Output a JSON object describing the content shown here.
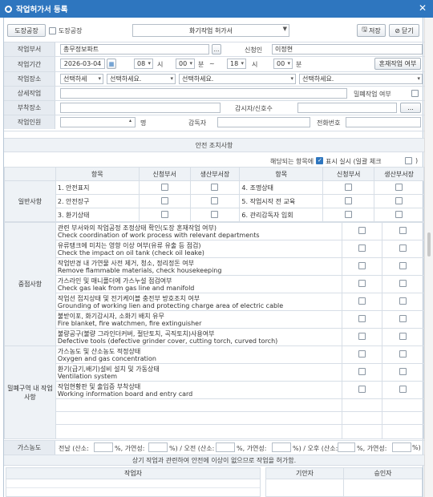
{
  "window": {
    "title": "작업허가서 등록",
    "close": "✕"
  },
  "toolbar": {
    "org_button": "도장공장",
    "org_check_label": "도장공장",
    "form_type": "화기작업 허가서",
    "save_label": "저장",
    "close_label": "닫기"
  },
  "form": {
    "dept_label": "작업부서",
    "dept_value": "총무정보파트",
    "applicant_label": "신청인",
    "applicant_value": "이정현",
    "period_label": "작업기간",
    "date_value": "2026-03-04",
    "start_hour": "08",
    "hour_unit": "시",
    "start_min": "00",
    "min_unit": "분",
    "tilde": "~",
    "end_hour": "18",
    "end_min": "00",
    "mixed_work_button": "혼재작업 여부",
    "place_label": "작업장소",
    "place_sel1": "선택하세",
    "place_sel2": "선택하세요.",
    "place_sel3": "선택하세요.",
    "place_sel4": "선택하세요.",
    "detail_label": "상세작업",
    "closed_work_label": "밀폐작업 여부",
    "attach_label": "부착장소",
    "supervisor_label": "감시자/신호수",
    "ellipsis": "...",
    "workers_label": "작업인원",
    "workers_unit": "명",
    "overseer_label": "감독자",
    "phone_label": "전화번호"
  },
  "safety": {
    "title": "안전 조치사항",
    "applicable_text": "해당되는 항목에",
    "show_label": "표시 실시 (일괄 체크",
    "close_paren": ")",
    "headers": {
      "item": "항목",
      "applicant_dept": "신청부서",
      "production_dept": "생산부서장"
    },
    "general_category": "일반사항",
    "general_items": [
      "1. 안전표지",
      "2. 안전장구",
      "3. 환기상태",
      "4. 조명상태",
      "5. 작업시작 전 교육",
      "6. 관리감독자 입회"
    ],
    "key_category": "중점사항",
    "key_items": [
      {
        "ko": "관련 부서와의 작업공정 조정상태 확인(도장 혼재작업 여부)",
        "en": "Check coordination of work process with relevant departments"
      },
      {
        "ko": "유류탱크에 미치는 영향 이상 여부(유류 유출 등 점검)",
        "en": "Check the impact on oil tank (check oil leake)"
      },
      {
        "ko": "작업반경 내 가연물 사전 제거, 청소, 정리정돈 여부",
        "en": "Remove flammable materials, check housekeeping"
      },
      {
        "ko": "가스라인 및 매니폴더에 가스누설 점검여부",
        "en": "Check gas leak from gas line and manifold"
      },
      {
        "ko": "작업선 접지상태 및 전기케이블 충전부 방호조치 여부",
        "en": "Grounding of working lien and protecting charge area of electric cable"
      },
      {
        "ko": "불받이포, 화기감시자, 소화기 배치 유무",
        "en": "Fire blanket, fire watchmen, fire extinguisher"
      },
      {
        "ko": "불량공구(불량 그라인더커버, 절단토치, 곡직토치)사용여부",
        "en": "Defective tools (defective grinder cover, cutting torch, curved torch)"
      }
    ],
    "closed_category": "밀폐구역 내 작업 사항",
    "closed_items": [
      {
        "ko": "가스농도 및 산소농도 적정상태",
        "en": "Oxygen and gas concentration"
      },
      {
        "ko": "환기(급기,배기)설비 설치 및 가동상태",
        "en": "Ventilation system"
      },
      {
        "ko": "작업현황판 및 출입증 부착상태",
        "en": "Working information board and entry card"
      }
    ]
  },
  "gas": {
    "label": "가스농도",
    "morning_prefix": "전날 (산소:",
    "comma_flam": "%,  가연성:",
    "pm_text": "%)  /  오전 (산소:",
    "pm2_text": "%)  /  오후 (산소:",
    "pct_close": "%)"
  },
  "footer": {
    "notice": "상기 작업과 관련하여 안전에 이상이 없으므로 작업을 허가함.",
    "writer_label": "작업자",
    "planner_label": "기안자",
    "approver_label": "승인자"
  },
  "colors": {
    "titlebar": "#2e76bf",
    "label_bg": "#e6ebf1",
    "check_on": "#2e76bf"
  }
}
